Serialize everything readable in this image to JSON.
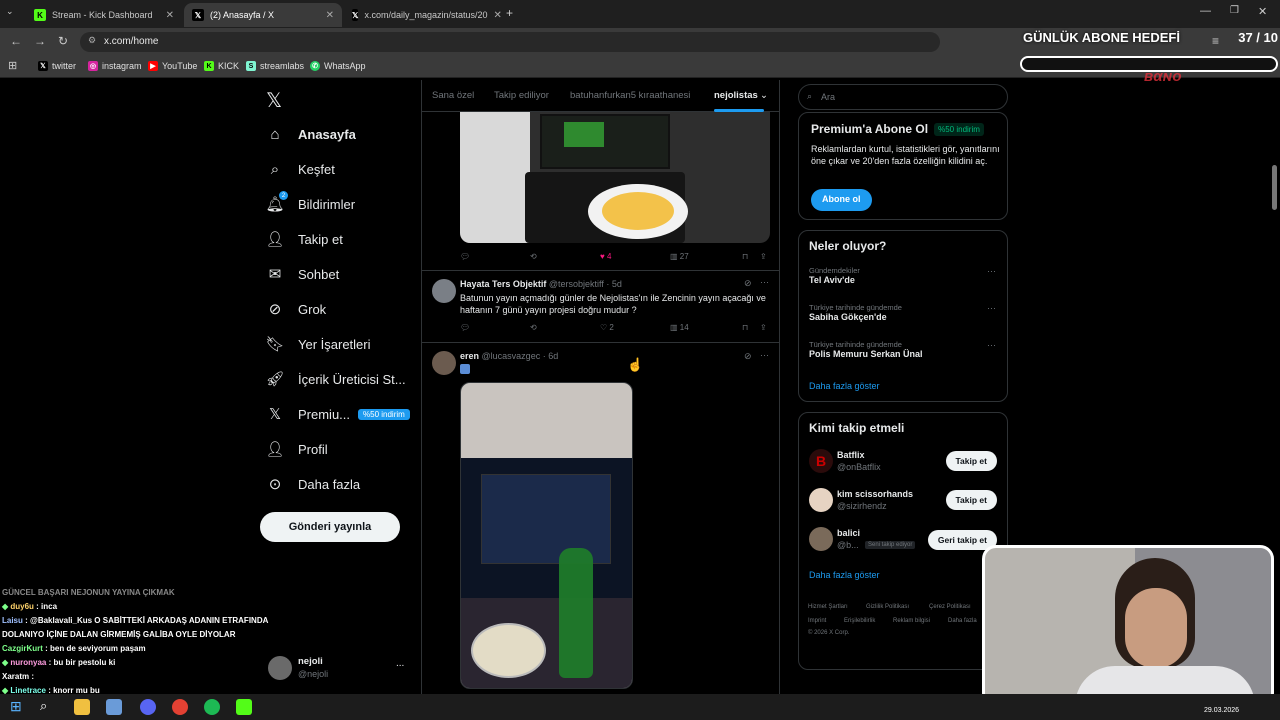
{
  "browser": {
    "tabs": [
      {
        "label": "Stream - Kick Dashboard",
        "active": false
      },
      {
        "label": "(2) Anasayfa / X",
        "active": true
      },
      {
        "label": "x.com/daily_magazin/status/20",
        "active": false
      }
    ],
    "url": "x.com/home",
    "bookmarks": [
      "twitter",
      "instagram",
      "YouTube",
      "KICK",
      "streamlabs",
      "WhatsApp"
    ]
  },
  "overlay": {
    "goal_title": "GÜNLÜK ABONE HEDEFİ",
    "goal_count": "37 / 10"
  },
  "leftnav": {
    "items": [
      "Anasayfa",
      "Keşfet",
      "Bildirimler",
      "Takip et",
      "Sohbet",
      "Grok",
      "Yer İşaretleri",
      "İçerik Üreticisi St...",
      "Premiu...",
      "Profil",
      "Daha fazla"
    ],
    "premium_badge": "%50 indirim",
    "notif_count": "2",
    "post_button": "Gönderi yayınla",
    "account_name": "nejoli",
    "account_handle": "@nejoli",
    "more": "..."
  },
  "feed": {
    "tabs": [
      "Sana özel",
      "Takip ediliyor",
      "batuhanfurkan5 kıraathanesi",
      "nejolistas"
    ],
    "tweet1": {
      "likes": "4",
      "views": "27"
    },
    "tweet2": {
      "name": "Hayata Ters Objektif",
      "handle": "@tersobjektiff",
      "time": "· 5d",
      "text": "Batunun yayın açmadığı günler de Nejolistas'ın ile Zencinin yayın açacağı ve haftanın 7 günü yayın projesi doğru mudur ?",
      "likes": "2",
      "views": "14"
    },
    "tweet3": {
      "name": "eren",
      "handle": "@lucasvazgec",
      "time": "· 6d"
    }
  },
  "right": {
    "search_placeholder": "Ara",
    "premium": {
      "title": "Premium'a Abone Ol",
      "badge": "%50 indirim",
      "text": "Reklamlardan kurtul, istatistikleri gör, yanıtlarını öne çıkar ve 20'den fazla özelliğin kilidini aç.",
      "button": "Abone ol"
    },
    "trends": {
      "title": "Neler oluyor?",
      "items": [
        {
          "cat": "Gündemdekiler",
          "name": "Tel Aviv'de"
        },
        {
          "cat": "Türkiye tarihinde gündemde",
          "name": "Sabiha Gökçen'de"
        },
        {
          "cat": "Türkiye tarihinde gündemde",
          "name": "Polis Memuru Serkan Ünal"
        }
      ],
      "more": "Daha fazla göster"
    },
    "follow": {
      "title": "Kimi takip etmeli",
      "items": [
        {
          "name": "Batflix",
          "handle": "@onBatflix",
          "button": "Takip et"
        },
        {
          "name": "kim scissorhands",
          "handle": "@sizirhendz",
          "button": "Takip et"
        },
        {
          "name": "balici",
          "handle": "@b...",
          "tag": "Seni takip ediyor",
          "button": "Geri takip et"
        }
      ],
      "more": "Daha fazla göster"
    },
    "footer": [
      "Hizmet Şartları",
      "Gizlilik Politikası",
      "Çerez Politikası",
      "Imprint",
      "Erişilebilirlik",
      "Reklam bilgisi",
      "Daha fazla",
      "© 2026 X Corp."
    ]
  },
  "chat": [
    {
      "user": "",
      "msg": "GÜNCEL BAŞARI NEJONUN YAYINA ÇIKMAK",
      "color": "#ffffff"
    },
    {
      "user": "duy6u",
      "msg": ": inca",
      "color": "#ffd36b"
    },
    {
      "user": "Laisu",
      "msg": ": @Baklavali_Kus O SABİTTEKİ ARKADAŞ ADANIN ETRAFINDA",
      "color": "#a0c0ff"
    },
    {
      "user": "",
      "msg": "DOLANIYO İÇİNE DALAN GİRMEMİŞ GALİBA OYLE DİYOLAR",
      "color": "#ffffff"
    },
    {
      "user": "CazgirKurt",
      "msg": ": ben de seviyorum paşam",
      "color": "#7dff8a"
    },
    {
      "user": "nuronyaa",
      "msg": ": bu bir pestolu ki",
      "color": "#ff9de0"
    },
    {
      "user": "Xaratm",
      "msg": ":",
      "color": "#ffffff"
    },
    {
      "user": "Linetrace",
      "msg": ": knorr mu bu",
      "color": "#7dffea"
    }
  ],
  "taskbar": {
    "date": "29.03.2026"
  }
}
